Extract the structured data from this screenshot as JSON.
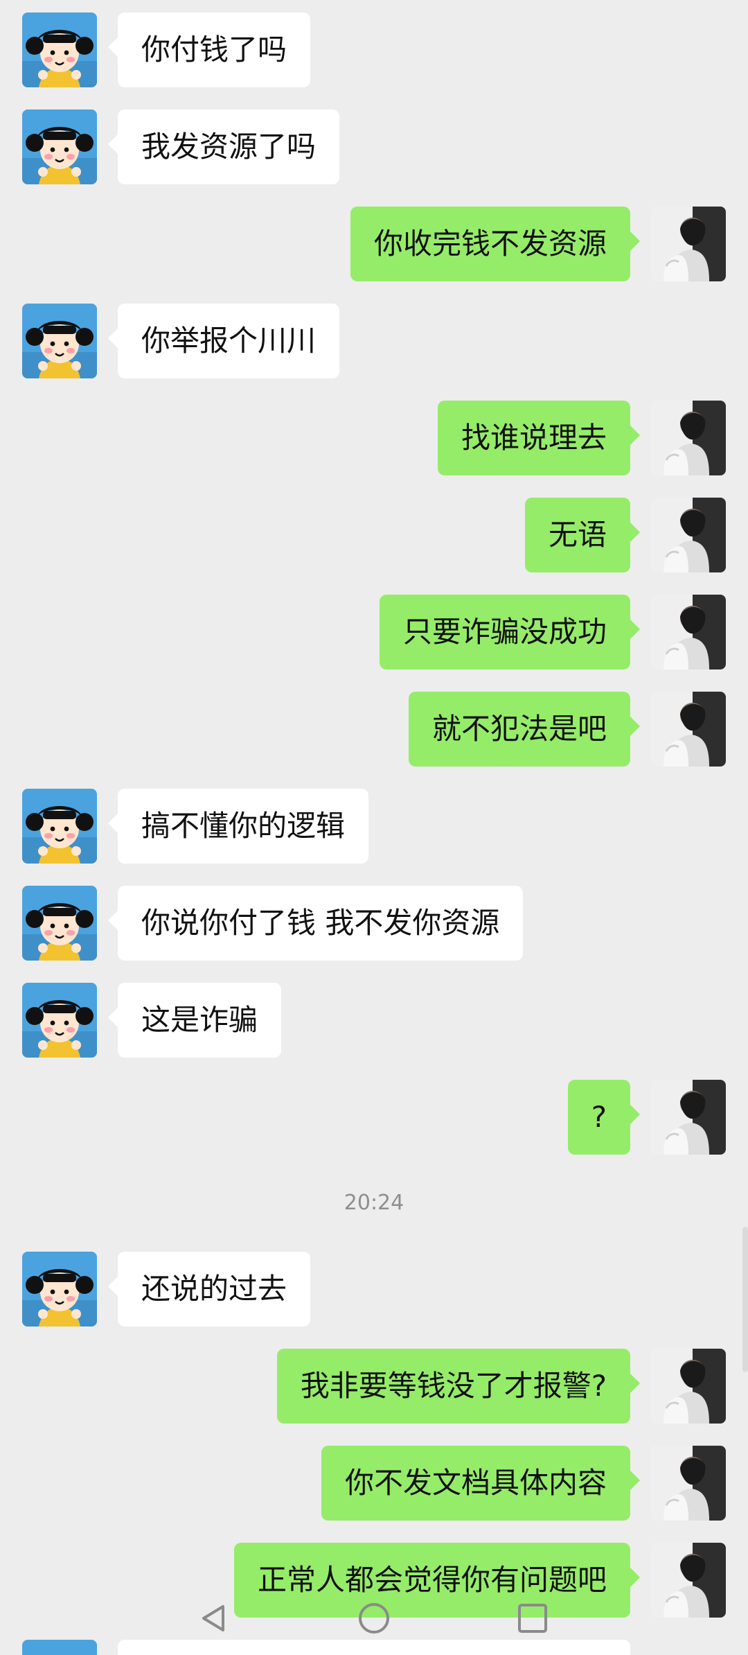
{
  "conversation": {
    "timestamp": "20:24",
    "messages": [
      {
        "side": "left",
        "text": "你付钱了吗"
      },
      {
        "side": "left",
        "text": "我发资源了吗"
      },
      {
        "side": "right",
        "text": "你收完钱不发资源"
      },
      {
        "side": "left",
        "text": "你举报个川川"
      },
      {
        "side": "right",
        "text": "找谁说理去"
      },
      {
        "side": "right",
        "text": "无语"
      },
      {
        "side": "right",
        "text": "只要诈骗没成功"
      },
      {
        "side": "right",
        "text": "就不犯法是吧"
      },
      {
        "side": "left",
        "text": "搞不懂你的逻辑"
      },
      {
        "side": "left",
        "text": "你说你付了钱 我不发你资源"
      },
      {
        "side": "left",
        "text": "这是诈骗"
      },
      {
        "side": "right",
        "text": "?"
      },
      {
        "side": "left",
        "text": "还说的过去"
      },
      {
        "side": "right",
        "text": "我非要等钱没了才报警?"
      },
      {
        "side": "right",
        "text": "你不发文档具体内容"
      },
      {
        "side": "right",
        "text": "正常人都会觉得你有问题吧"
      },
      {
        "side": "left",
        "text": ""
      }
    ]
  },
  "colors": {
    "background": "#ededed",
    "incoming_bubble": "#ffffff",
    "outgoing_bubble": "#95ec69"
  },
  "icons": {
    "incoming_avatar": "cartoon-girl-avatar",
    "outgoing_avatar": "profile-photo-avatar",
    "nav_back": "triangle-back-icon",
    "nav_home": "circle-home-icon",
    "nav_recent": "square-recent-icon"
  }
}
